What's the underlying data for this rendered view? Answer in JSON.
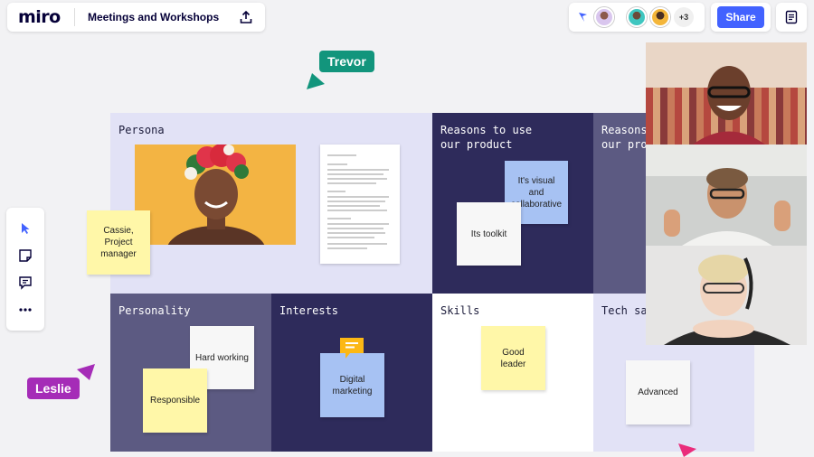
{
  "app": {
    "logo": "miro",
    "board_title": "Meetings and Workshops"
  },
  "header": {
    "collaborators_extra": "+3",
    "share_label": "Share"
  },
  "toolbar": {
    "tools": [
      "select",
      "sticky-note",
      "comment",
      "more"
    ]
  },
  "board": {
    "cells": {
      "persona": "Persona",
      "reasons1": "Reasons to use\nour product",
      "reasons2": "Reasons\nour pro",
      "personality": "Personality",
      "interests": "Interests",
      "skills": "Skills",
      "techsav": "Tech sa"
    },
    "stickies": {
      "cassie": "Cassie,\nProject\nmanager",
      "visual": "It's visual and\ncollaborative",
      "toolkit": "Its toolkit",
      "hard_working": "Hard working",
      "responsible": "Responsible",
      "digital": "Digital\nmarketing",
      "good_leader": "Good\nleader",
      "advanced": "Advanced"
    }
  },
  "cursors": {
    "trevor": "Trevor",
    "leslie": "Leslie"
  },
  "colors": {
    "brand_blue": "#4262ff",
    "trevor": "#12957c",
    "leslie": "#a52cb7",
    "lavender": "#e2e2f6",
    "navy": "#2e2b5b",
    "slate": "#5c5a82",
    "sticky_yellow": "#fff7a8",
    "sticky_blue": "#a7c2f3"
  }
}
